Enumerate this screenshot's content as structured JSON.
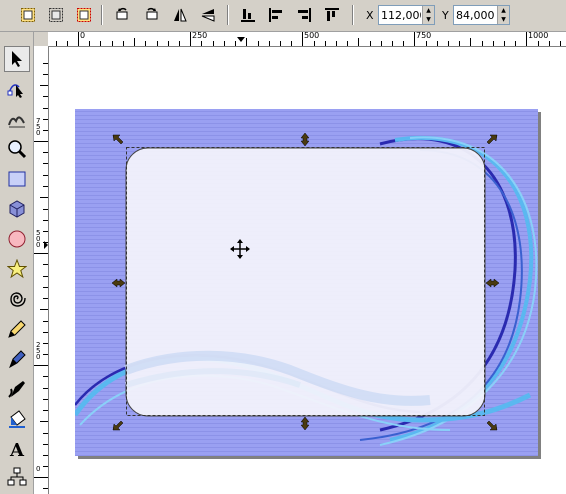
{
  "toolbar": {
    "buttons": [
      "wrap-text-icon",
      "fit-frame-icon",
      "text-frame-icon",
      "rotate-ccw-icon",
      "rotate-cw-icon",
      "flip-horizontal-icon",
      "flip-vertical-icon",
      "align-bottom-icon",
      "align-left-icon",
      "align-right-icon",
      "align-top-icon"
    ],
    "x_label": "X",
    "x_value": "112,000",
    "y_label": "Y",
    "y_value": "84,000"
  },
  "ruler": {
    "h_ticks": [
      "0",
      "250",
      "500",
      "750",
      "1000"
    ],
    "v_ticks": [
      "750",
      "500",
      "250",
      "0"
    ]
  },
  "toolbox": {
    "tools": [
      "pointer-tool-icon",
      "node-edit-tool-icon",
      "tweak-tool-icon",
      "zoom-tool-icon",
      "rectangle-tool-icon",
      "3d-box-tool-icon",
      "ellipse-tool-icon",
      "star-tool-icon",
      "spiral-tool-icon",
      "pencil-tool-icon",
      "pen-tool-icon",
      "calligraphy-tool-icon",
      "paint-bucket-tool-icon",
      "text-tool-icon",
      "connector-tool-icon"
    ],
    "selected": 0
  },
  "colors": {
    "chrome": "#d4d0c8",
    "background_frame": "#9a9ef0",
    "inner_panel": "#f0f0fa",
    "swirl_dark": "#2a2ab0",
    "swirl_light": "#5ab8f0",
    "handle": "#4a3a10"
  }
}
